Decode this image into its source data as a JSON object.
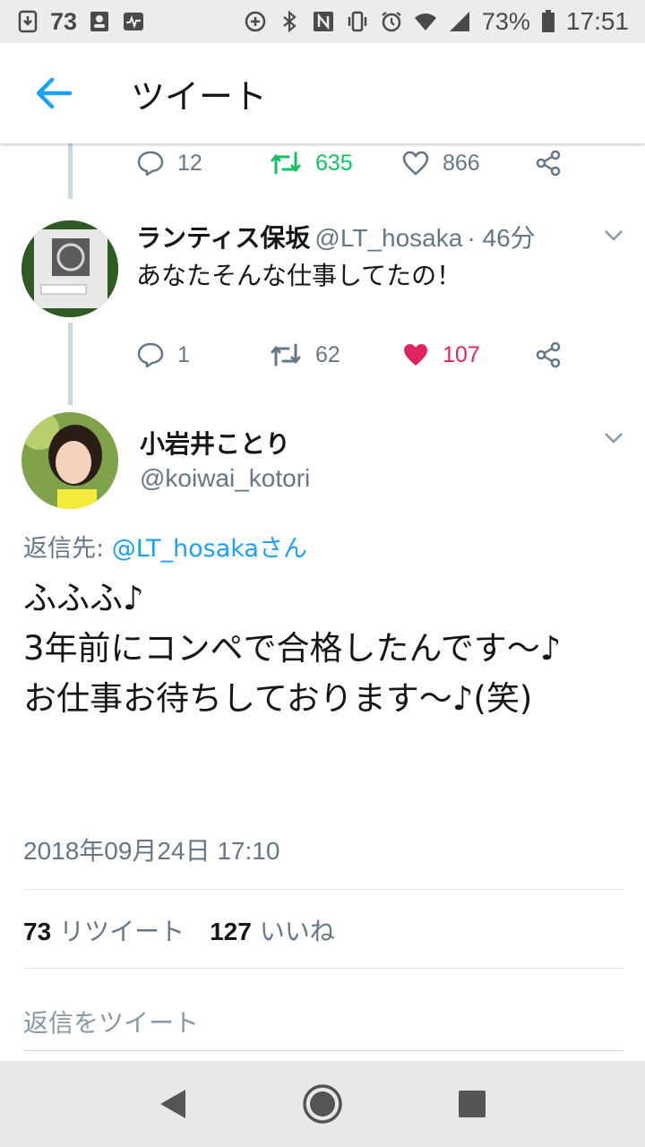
{
  "status_bar": {
    "left_number": "73",
    "battery": "73%",
    "time": "17:51",
    "icons": [
      "download-icon",
      "contacts-icon",
      "activity-icon",
      "data-saver-icon",
      "bluetooth-icon",
      "nfc-icon",
      "vibrate-icon",
      "alarm-icon",
      "wifi-icon",
      "signal-icon",
      "battery-icon"
    ]
  },
  "header": {
    "title": "ツイート",
    "back_icon": "arrow-left-icon"
  },
  "prev_tweet_actions": {
    "replies": "12",
    "retweets": "635",
    "likes": "866"
  },
  "reply_tweet": {
    "name": "ランティス保坂",
    "handle": "@LT_hosaka",
    "time": "· 46分",
    "text": "あなたそんな仕事してたの！",
    "replies": "1",
    "retweets": "62",
    "likes": "107"
  },
  "main_tweet": {
    "name": "小岩井ことり",
    "handle": "@koiwai_kotori",
    "reply_prefix": "返信先: ",
    "reply_mention": "@LT_hosakaさん",
    "text": "ふふふ♪\n3年前にコンペで合格したんです〜♪\nお仕事お待ちしております〜♪(笑)",
    "timestamp": "2018年09月24日 17:10",
    "retweet_count": "73",
    "retweet_label": "リツイート",
    "like_count": "127",
    "like_label": "いいね"
  },
  "reply_box": {
    "placeholder": "返信をツイート"
  },
  "colors": {
    "accent": "#1da1f2",
    "retweet_green": "#17bf63",
    "like_red": "#e0245e",
    "muted": "#657786"
  }
}
